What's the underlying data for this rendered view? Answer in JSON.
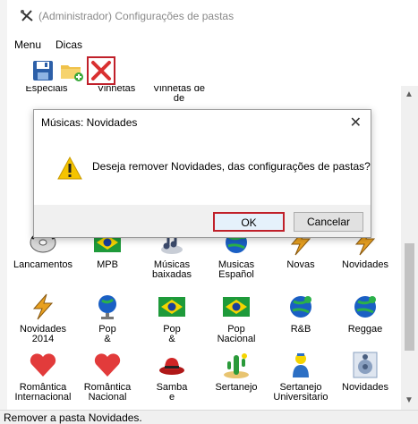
{
  "window": {
    "title": "(Administrador) Configurações de pastas"
  },
  "menu": {
    "items": [
      "Menu",
      "Dicas"
    ]
  },
  "toolbar": {
    "buttons": [
      "save-icon",
      "new-folder-icon",
      "delete-icon"
    ]
  },
  "grid": {
    "partial_top_labels": [
      "Especiais",
      "Vinhetas",
      "Vinhetas de"
    ],
    "items": [
      {
        "label": "Lancamentos",
        "icon": "cd-icon"
      },
      {
        "label": "MPB",
        "icon": "brazil-flag-icon"
      },
      {
        "label": "Músicas baixadas",
        "icon": "music-download-icon"
      },
      {
        "label": "Musicas Español",
        "icon": "globe-music-icon"
      },
      {
        "label": "Novas",
        "icon": "lightning-icon"
      },
      {
        "label": "Novidades",
        "icon": "lightning-icon"
      },
      {
        "label": "Novidades 2014",
        "icon": "lightning-icon"
      },
      {
        "label": "Pop &",
        "icon": "globe-stand-icon"
      },
      {
        "label": "Pop &",
        "icon": "brazil-flag-icon"
      },
      {
        "label": "Pop Nacional",
        "icon": "brazil-flag-icon"
      },
      {
        "label": "R&B",
        "icon": "globe-music-icon"
      },
      {
        "label": "Reggae",
        "icon": "globe-music-icon"
      },
      {
        "label": "Romântica Internacional",
        "icon": "heart-icon"
      },
      {
        "label": "Romântica Nacional",
        "icon": "heart-icon"
      },
      {
        "label": "Samba e",
        "icon": "hat-icon"
      },
      {
        "label": "Sertanejo",
        "icon": "cactus-icon"
      },
      {
        "label": "Sertanejo Universitario",
        "icon": "person-icon"
      },
      {
        "label": "Novidades",
        "icon": "speaker-icon"
      }
    ]
  },
  "dialog": {
    "title": "Músicas: Novidades",
    "message": "Deseja remover Novidades, das configurações de pastas?",
    "ok_label": "OK",
    "cancel_label": "Cancelar",
    "close_glyph": "✕"
  },
  "status": {
    "text": "Remover a pasta Novidades."
  },
  "colors": {
    "highlight_red": "#c0202a",
    "flag_green": "#1e9a3a",
    "flag_yellow": "#f5d400",
    "globe_blue": "#1a5fc4",
    "heart_red": "#e23b3b",
    "lightning_orange": "#e8a020"
  }
}
